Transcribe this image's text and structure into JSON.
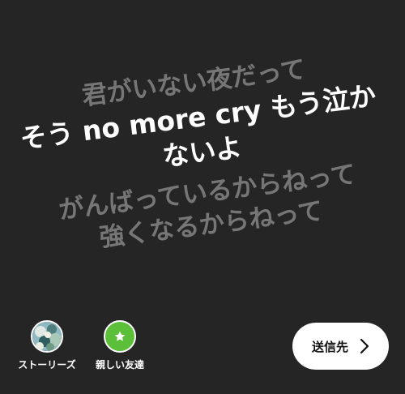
{
  "lyrics": {
    "before": [
      "君がいない夜だって"
    ],
    "active": [
      "そう no more cry もう泣か",
      "ないよ"
    ],
    "after": [
      "がんばっているからねって",
      "強くなるからねって"
    ]
  },
  "share": {
    "stories": {
      "label": "ストーリーズ",
      "icon": "stories-avatar-icon"
    },
    "close_friends": {
      "label": "親しい友達",
      "icon": "star-icon",
      "color": "#5bbf3a"
    }
  },
  "send": {
    "label": "送信先",
    "icon": "chevron-right-icon"
  },
  "colors": {
    "background": "#252525",
    "lyric_active": "#ffffff",
    "lyric_dim": "#767676"
  }
}
